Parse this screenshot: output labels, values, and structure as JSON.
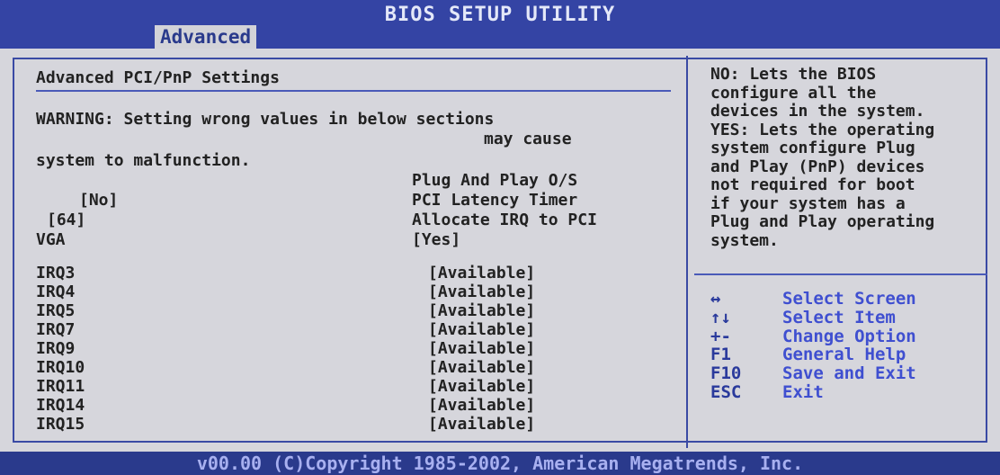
{
  "header": {
    "title": "BIOS SETUP UTILITY",
    "active_tab": "Advanced"
  },
  "main": {
    "section_title": "Advanced PCI/PnP Settings",
    "warning_line1": "WARNING: Setting wrong values in below sections",
    "warning_line2": "may cause",
    "warning_line3": "system to malfunction.",
    "settings": [
      {
        "label": "Plug And Play O/S",
        "value": "[No]"
      },
      {
        "label": "PCI Latency Timer",
        "value": "[64]"
      },
      {
        "label": "Allocate IRQ to PCI VGA",
        "value": "[Yes]"
      }
    ],
    "label_vga_line": "VGA",
    "irqs": [
      {
        "label": "IRQ3",
        "value": "[Available]"
      },
      {
        "label": "IRQ4",
        "value": "[Available]"
      },
      {
        "label": "IRQ5",
        "value": "[Available]"
      },
      {
        "label": "IRQ7",
        "value": "[Available]"
      },
      {
        "label": "IRQ9",
        "value": "[Available]"
      },
      {
        "label": "IRQ10",
        "value": "[Available]"
      },
      {
        "label": "IRQ11",
        "value": "[Available]"
      },
      {
        "label": "IRQ14",
        "value": "[Available]"
      },
      {
        "label": "IRQ15",
        "value": "[Available]"
      }
    ]
  },
  "help": {
    "text": "NO: Lets the BIOS\nconfigure all the\ndevices in the system.\nYES: Lets the operating\nsystem configure Plug\nand Play (PnP) devices\nnot required for boot\nif your system has a\nPlug and Play operating\nsystem."
  },
  "keys": [
    {
      "key": "↔",
      "desc": "Select Screen"
    },
    {
      "key": "↑↓",
      "desc": "Select Item"
    },
    {
      "key": "+-",
      "desc": "Change Option"
    },
    {
      "key": "F1",
      "desc": "General Help"
    },
    {
      "key": "F10",
      "desc": "Save and Exit"
    },
    {
      "key": "ESC",
      "desc": "Exit"
    }
  ],
  "footer": {
    "text": "v00.00 (C)Copyright 1985-2002, American Megatrends, Inc."
  },
  "colors": {
    "background_blue": "#2a3a8c",
    "panel_gray": "#d6d6dc",
    "accent_blue": "#3f4fd0"
  }
}
